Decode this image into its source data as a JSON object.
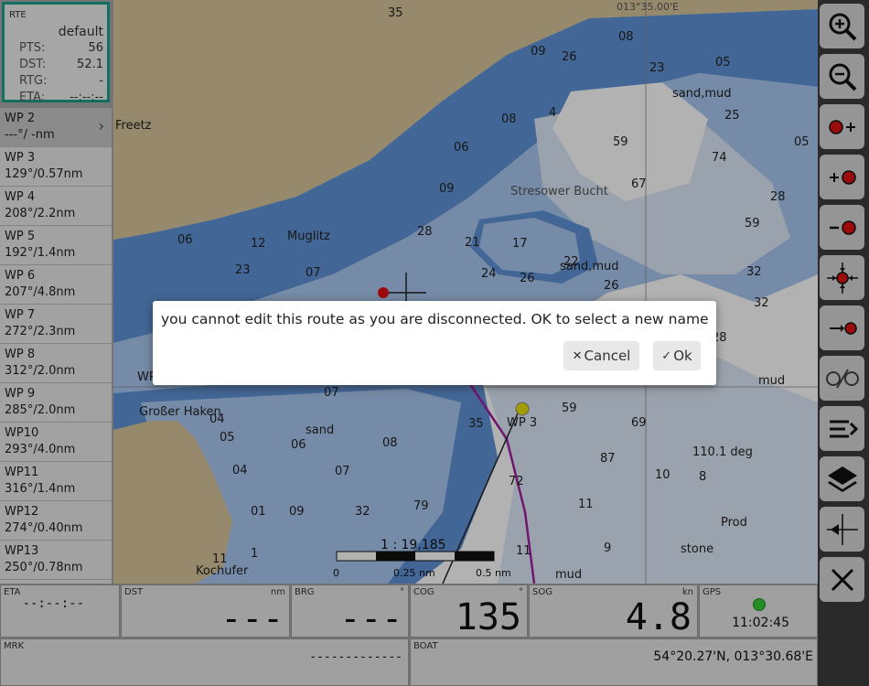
{
  "route": {
    "header": "RTE",
    "name": "default",
    "stats": [
      {
        "label": "PTS:",
        "value": "56"
      },
      {
        "label": "DST:",
        "value": "52.1"
      },
      {
        "label": "RTG:",
        "value": "-"
      },
      {
        "label": "ETA:",
        "value": "--:--:--"
      }
    ]
  },
  "waypoints": [
    {
      "name": "WP 2",
      "info": "---°/ -nm"
    },
    {
      "name": "WP 3",
      "info": "129°/0.57nm"
    },
    {
      "name": "WP 4",
      "info": "208°/2.2nm"
    },
    {
      "name": "WP 5",
      "info": "192°/1.4nm"
    },
    {
      "name": "WP 6",
      "info": "207°/4.8nm"
    },
    {
      "name": "WP 7",
      "info": "272°/2.3nm"
    },
    {
      "name": "WP 8",
      "info": "312°/2.0nm"
    },
    {
      "name": "WP 9",
      "info": "285°/2.0nm"
    },
    {
      "name": "WP10",
      "info": "293°/4.0nm"
    },
    {
      "name": "WP11",
      "info": "316°/1.4nm"
    },
    {
      "name": "WP12",
      "info": "274°/0.40nm"
    },
    {
      "name": "WP13",
      "info": "250°/0.78nm"
    }
  ],
  "map": {
    "labels": {
      "freetz": "Freetz",
      "muglitz": "Muglitz",
      "bucht": "Stresower Bucht",
      "sandmud1": "sand,mud",
      "sandmud2": "sand,mud",
      "grosser_haken": "Großer Haken",
      "sand": "sand",
      "kochufer": "Kochufer",
      "wp3": "WP 3",
      "wp_partial": "WP",
      "mud1": "mud",
      "mud2": "mud",
      "stone": "stone",
      "prod": "Prod",
      "deg": "110.1 deg",
      "lon_top": "013°35.00'E"
    },
    "scale": {
      "ratio": "1 : 19,185",
      "tick0": "0",
      "tick1": "0.25 nm",
      "tick2": "0.5 nm"
    }
  },
  "dialog": {
    "message": "you cannot edit this route as you are disconnected. OK to select a new name",
    "cancel_label": "Cancel",
    "ok_label": "Ok"
  },
  "toolbar": [
    "zoom-in-icon",
    "zoom-out-icon",
    "add-waypoint-icon",
    "insert-after-icon",
    "delete-waypoint-icon",
    "center-icon",
    "goto-waypoint-icon",
    "route-invert-icon",
    "route-list-icon",
    "layers-icon",
    "marker-icon",
    "close-icon"
  ],
  "instruments": {
    "eta": {
      "label": "ETA",
      "value": "--:--:--"
    },
    "dst": {
      "label": "DST",
      "unit": "nm",
      "value": "---"
    },
    "brg": {
      "label": "BRG",
      "unit": "°",
      "value": "---"
    },
    "cog": {
      "label": "COG",
      "unit": "°",
      "value": "135"
    },
    "sog": {
      "label": "SOG",
      "unit": "kn",
      "value": "4.8"
    },
    "gps": {
      "label": "GPS",
      "time": "11:02:45",
      "status_color": "#33cc33"
    },
    "mrk": {
      "label": "MRK",
      "value": "-------------"
    },
    "boat": {
      "label": "BOAT",
      "value": "54°20.27'N, 013°30.68'E"
    }
  },
  "colors": {
    "accent": "#1c9f8a",
    "land": "#d8c59a",
    "deep": "#5f93d6",
    "shallow": "#a9c7f0",
    "flat": "#ffffff",
    "route": "#a020a0"
  }
}
